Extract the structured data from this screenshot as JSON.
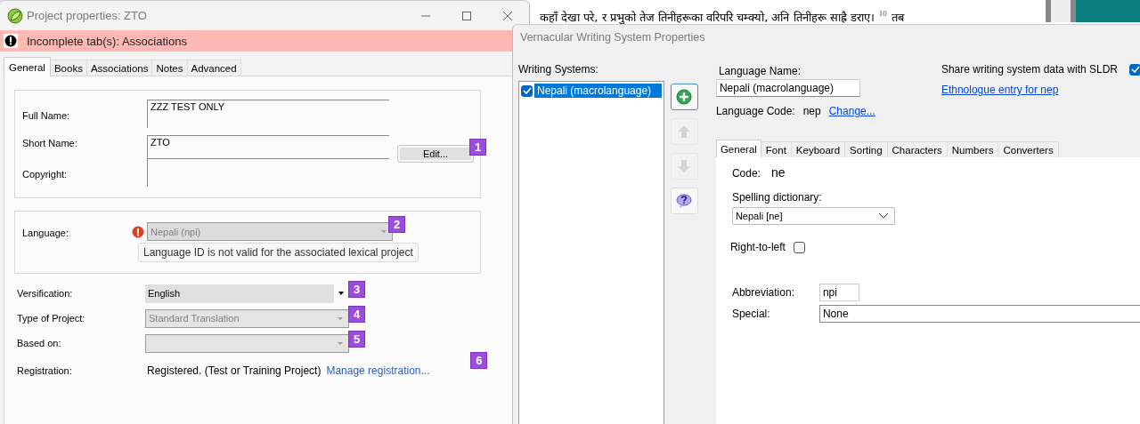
{
  "background_window": {
    "scripture_text": "कहाँ देखा परे, र प्रभुको तेज तिनीहरूका वरिपरि चम्क्यो, अनि तिनीहरू साह्रै डराए।",
    "verse_number": "10",
    "next_word": "तब"
  },
  "project_window": {
    "title": "Project properties: ZTO",
    "banner": {
      "text": "Incomplete tab(s): Associations"
    },
    "tabs": [
      {
        "label": "General",
        "selected": true
      },
      {
        "label": "Books",
        "selected": false
      },
      {
        "label": "Associations",
        "selected": false
      },
      {
        "label": "Notes",
        "selected": false
      },
      {
        "label": "Advanced",
        "selected": false
      }
    ],
    "names_group": [
      {
        "label": "Full Name:",
        "value": "ZZZ TEST ONLY",
        "kind": "tall"
      },
      {
        "label": "Short Name:",
        "value": "ZTO",
        "kind": "short"
      },
      {
        "label": "Copyright:",
        "kind": "tall"
      }
    ],
    "edit_button": {
      "label": "Edit...",
      "callout": "1"
    },
    "language": {
      "label": "Language:",
      "value": "Nepali (npi)",
      "disabled": true,
      "error": true,
      "callout": "2",
      "tooltip": "Language ID is not valid for the associated lexical project"
    },
    "settings": [
      {
        "label": "Versification:",
        "value": "English",
        "disabled": false,
        "callout": "3"
      },
      {
        "label": "Type of Project:",
        "value": "Standard Translation",
        "disabled": true,
        "callout": "4"
      },
      {
        "label": "Based on:",
        "disabled": true,
        "callout": "5"
      }
    ],
    "registration": {
      "label": "Registration:",
      "status": "Registered. (Test or Training Project)",
      "link": "Manage registration...",
      "callout": "6"
    }
  },
  "vernacular_window": {
    "title": "Vernacular Writing System Properties",
    "writing_systems_label": "Writing Systems:",
    "writing_systems": [
      {
        "name": "Nepali (macrolanguage)",
        "checked": true,
        "selected": true
      }
    ],
    "side_buttons": [
      {
        "kind": "add",
        "disabled": false
      },
      {
        "kind": "up",
        "disabled": true
      },
      {
        "kind": "down",
        "disabled": true
      },
      {
        "kind": "help",
        "disabled": false
      }
    ],
    "language_name": {
      "label": "Language Name:",
      "value": "Nepali (macrolanguage)"
    },
    "language_code": {
      "label": "Language Code:",
      "value": "nep",
      "link": "Change..."
    },
    "share_sldr": {
      "label": "Share writing system data with SLDR",
      "checked": true
    },
    "ethnologue_link": "Ethnologue entry for nep",
    "tabs": [
      {
        "label": "General",
        "selected": true
      },
      {
        "label": "Font",
        "selected": false
      },
      {
        "label": "Keyboard",
        "selected": false
      },
      {
        "label": "Sorting",
        "selected": false
      },
      {
        "label": "Characters",
        "selected": false
      },
      {
        "label": "Numbers",
        "selected": false
      },
      {
        "label": "Converters",
        "selected": false
      }
    ],
    "general": {
      "code": {
        "label": "Code:",
        "value": "ne"
      },
      "spelling": {
        "label": "Spelling dictionary:",
        "value": "Nepali [ne]"
      },
      "right_to_left": {
        "label": "Right-to-left",
        "checked": false
      },
      "abbreviation": {
        "label": "Abbreviation:",
        "value": "npi"
      },
      "special": {
        "label": "Special:",
        "value": "None"
      }
    }
  }
}
